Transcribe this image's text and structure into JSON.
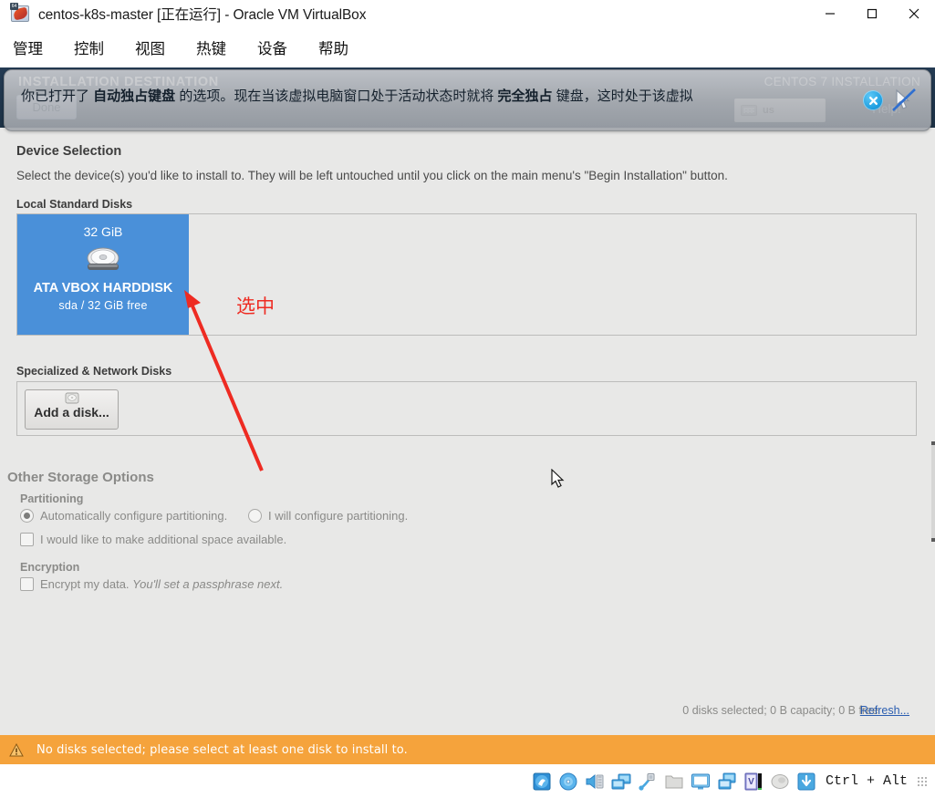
{
  "window": {
    "title": "centos-k8s-master [正在运行] - Oracle VM VirtualBox",
    "app_icon": "virtualbox-icon",
    "controls": {
      "minimize": "minimize-icon",
      "maximize": "maximize-icon",
      "close": "close-icon"
    }
  },
  "menubar": {
    "items": [
      {
        "label": "管理"
      },
      {
        "label": "控制"
      },
      {
        "label": "视图"
      },
      {
        "label": "热键"
      },
      {
        "label": "设备"
      },
      {
        "label": "帮助"
      }
    ]
  },
  "notification": {
    "message_parts": [
      {
        "text": "你已打开了 ",
        "bold": false
      },
      {
        "text": "自动独占键盘",
        "bold": true
      },
      {
        "text": " 的选项。现在当该虚拟电脑窗口处于活动状态时就将 ",
        "bold": false
      },
      {
        "text": "完全独占",
        "bold": true
      },
      {
        "text": " 键盘，这时处于该虚拟",
        "bold": false
      }
    ],
    "message_plain": "你已打开了 自动独占键盘 的选项。现在当该虚拟电脑窗口处于活动状态时就将 完全独占 键盘，这时处于该虚拟",
    "close_icon": "close-circle-icon",
    "mouse_disabled_icon": "mouse-disabled-icon"
  },
  "installer": {
    "header": {
      "title": "INSTALLATION DESTINATION",
      "brand": "CENTOS 7 INSTALLATION",
      "done_label": "Done",
      "help_label": "Help!",
      "keyboard_layout": "us",
      "keyboard_icon": "keyboard-icon"
    },
    "device_selection": {
      "title": "Device Selection",
      "description": "Select the device(s) you'd like to install to.  They will be left untouched until you click on the main menu's \"Begin Installation\" button.",
      "local_disks_label": "Local Standard Disks",
      "disks": [
        {
          "capacity": "32 GiB",
          "name": "ATA VBOX HARDDISK",
          "detail": "sda  /  32 GiB free",
          "selected": true,
          "icon": "harddisk-icon"
        }
      ],
      "specialized_label": "Specialized & Network Disks",
      "add_disk_label": "Add a disk...",
      "add_disk_icon": "harddisk-small-icon"
    },
    "other_storage": {
      "title": "Other Storage Options",
      "partitioning_label": "Partitioning",
      "options": [
        {
          "label": "Automatically configure partitioning.",
          "type": "radio",
          "checked": true
        },
        {
          "label": "I will configure partitioning.",
          "type": "radio",
          "checked": false
        },
        {
          "label": "I would like to make additional space available.",
          "type": "checkbox",
          "checked": false
        }
      ],
      "encryption_label": "Encryption",
      "encryption_option": {
        "label_plain": "Encrypt my data. You'll set a passphrase next.",
        "label_normal": "Encrypt my data. ",
        "label_italic": "You'll set a passphrase next.",
        "type": "checkbox",
        "checked": false
      }
    },
    "footer": {
      "summary": "0 disks selected; 0 B capacity; 0 B free",
      "refresh_label": "Refresh..."
    },
    "warning": {
      "icon": "warning-icon",
      "text": "No disks selected; please select at least one disk to install to."
    }
  },
  "annotation": {
    "label": "选中",
    "color": "#ee2b22",
    "arrow": "red-arrow"
  },
  "statusbar": {
    "icons": [
      {
        "name": "hard-disk-icon"
      },
      {
        "name": "optical-drive-icon"
      },
      {
        "name": "audio-icon"
      },
      {
        "name": "network-icon"
      },
      {
        "name": "usb-icon"
      },
      {
        "name": "shared-folders-icon"
      },
      {
        "name": "display-icon"
      },
      {
        "name": "recording-icon"
      },
      {
        "name": "vrdp-icon"
      },
      {
        "name": "mouse-integration-icon"
      },
      {
        "name": "host-key-icon"
      }
    ],
    "host_key": "Ctrl + Alt",
    "resize_grip": "resize-grip-icon"
  },
  "colors": {
    "accent_blue": "#4a90d9",
    "warning_orange": "#f5a33c",
    "header_navy": "#243b53",
    "annotation_red": "#ee2b22",
    "panel_bg": "#e8e8e7",
    "link_blue": "#2a5db0"
  }
}
